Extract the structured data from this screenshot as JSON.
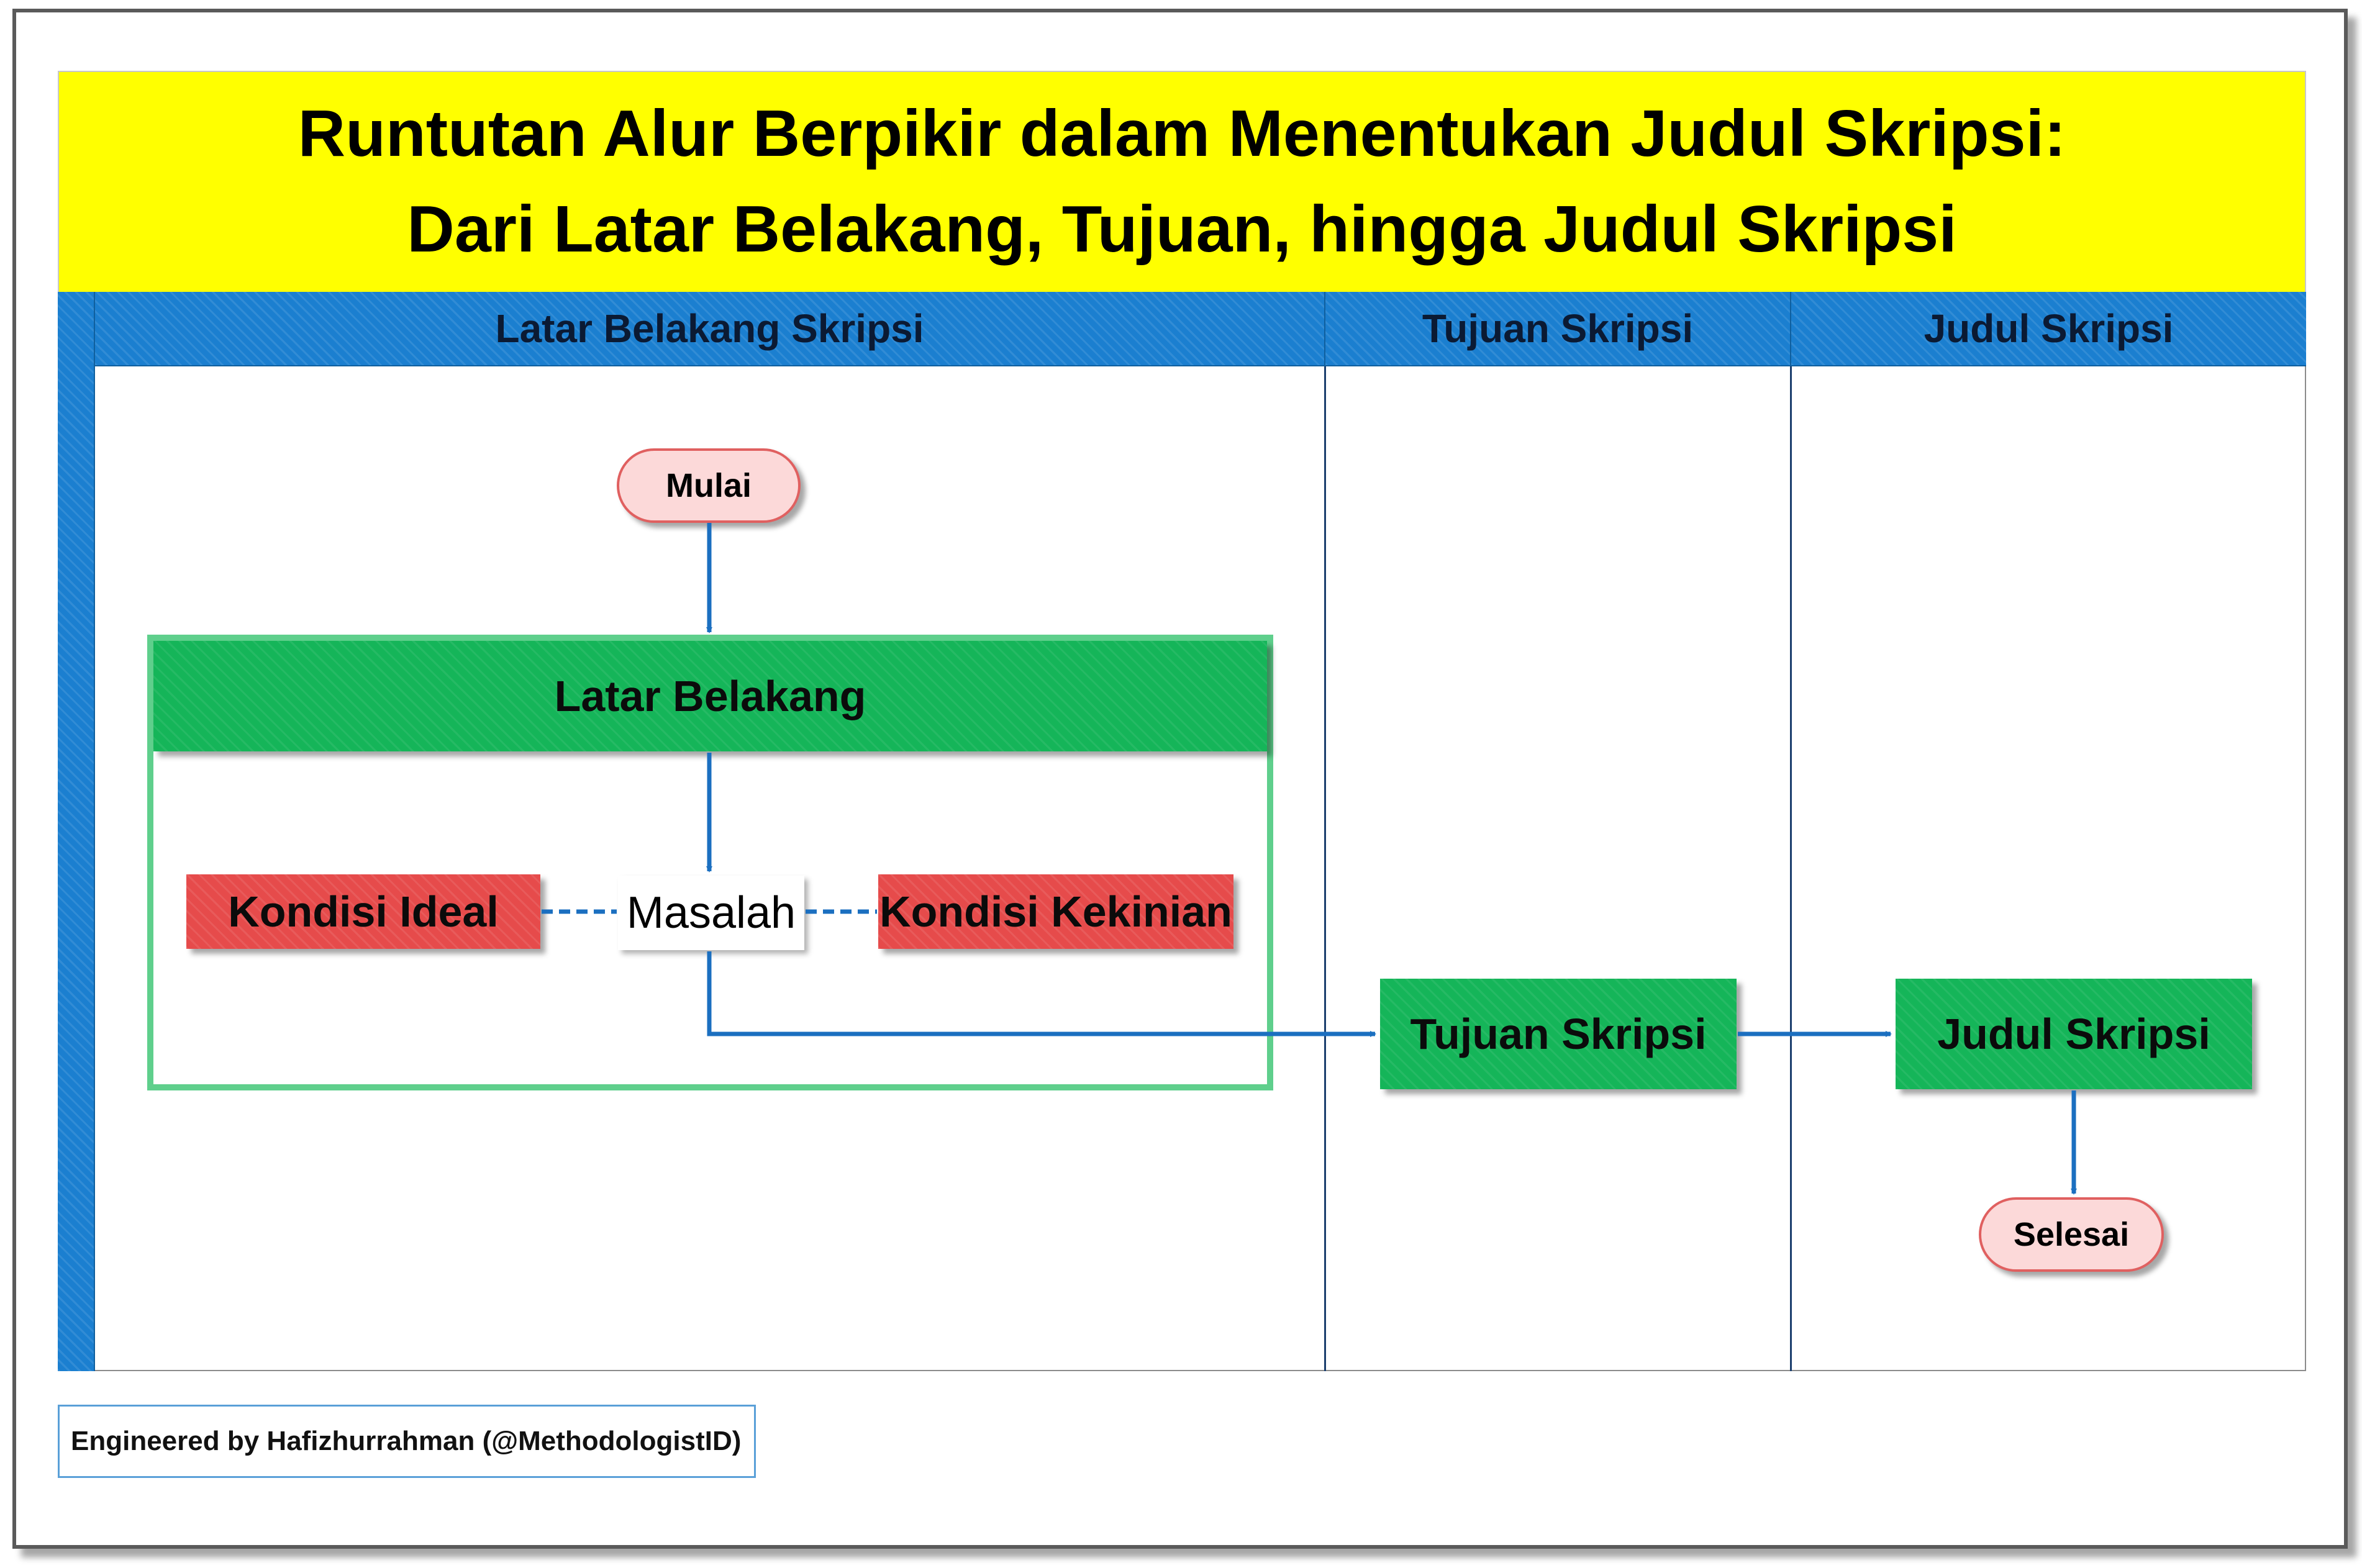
{
  "title": {
    "line1": "Runtutan Alur Berpikir dalam Menentukan Judul Skripsi:",
    "line2": "Dari Latar Belakang, Tujuan, hingga Judul Skripsi"
  },
  "lanes": [
    {
      "label": "Latar Belakang Skripsi"
    },
    {
      "label": "Tujuan Skripsi"
    },
    {
      "label": "Judul Skripsi"
    }
  ],
  "nodes": {
    "start": "Mulai",
    "background_group": "Latar Belakang",
    "ideal": "Kondisi Ideal",
    "problem": "Masalah",
    "current": "Kondisi Kekinian",
    "objective": "Tujuan Skripsi",
    "thesis_title": "Judul Skripsi",
    "end": "Selesai"
  },
  "credit": "Engineered by Hafizhurrahman (@MethodologistID)",
  "colors": {
    "title_bg": "#ffff00",
    "lane_header": "#1b7fd0",
    "process_green": "#15b559",
    "condition_red": "#e64b4b",
    "terminator_fill": "#fcd9d9",
    "terminator_border": "#e06060",
    "arrow": "#1b6fc0"
  }
}
